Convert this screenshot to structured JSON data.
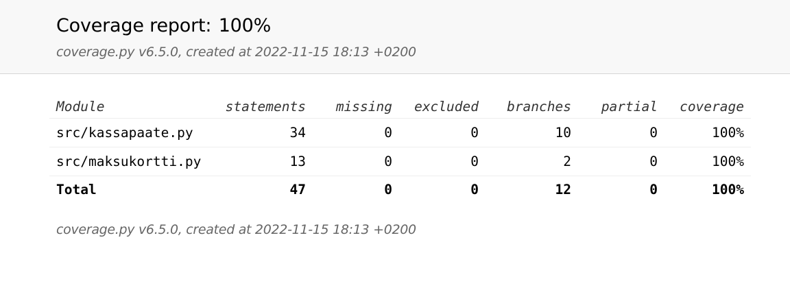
{
  "header": {
    "title_prefix": "Coverage report:",
    "title_percent": "100%",
    "meta": "coverage.py v6.5.0, created at 2022-11-15 18:13 +0200"
  },
  "table": {
    "columns": [
      "Module",
      "statements",
      "missing",
      "excluded",
      "branches",
      "partial",
      "coverage"
    ],
    "rows": [
      {
        "module": "src/kassapaate.py",
        "statements": "34",
        "missing": "0",
        "excluded": "0",
        "branches": "10",
        "partial": "0",
        "coverage": "100%"
      },
      {
        "module": "src/maksukortti.py",
        "statements": "13",
        "missing": "0",
        "excluded": "0",
        "branches": "2",
        "partial": "0",
        "coverage": "100%"
      }
    ],
    "total": {
      "module": "Total",
      "statements": "47",
      "missing": "0",
      "excluded": "0",
      "branches": "12",
      "partial": "0",
      "coverage": "100%"
    }
  },
  "footer": {
    "meta": "coverage.py v6.5.0, created at 2022-11-15 18:13 +0200"
  }
}
